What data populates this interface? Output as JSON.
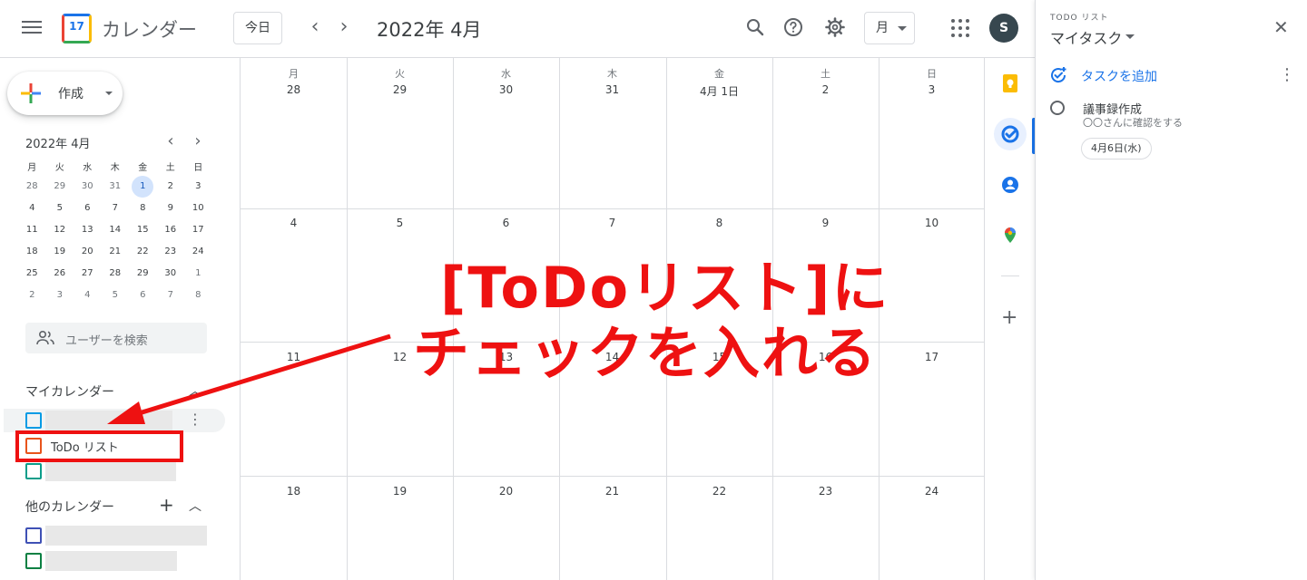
{
  "header": {
    "app_title": "カレンダー",
    "logo_number": "17",
    "today_label": "今日",
    "prev_label": "‹",
    "next_label": "›",
    "month_title": "2022年 4月",
    "view_label": "月",
    "avatar_initial": "S"
  },
  "sidebar": {
    "create_label": "作成",
    "mini_title": "2022年 4月",
    "mini_prev": "‹",
    "mini_next": "›",
    "weekdays": [
      "月",
      "火",
      "水",
      "木",
      "金",
      "土",
      "日"
    ],
    "weeks": [
      [
        "28",
        "29",
        "30",
        "31",
        "1",
        "2",
        "3"
      ],
      [
        "4",
        "5",
        "6",
        "7",
        "8",
        "9",
        "10"
      ],
      [
        "11",
        "12",
        "13",
        "14",
        "15",
        "16",
        "17"
      ],
      [
        "18",
        "19",
        "20",
        "21",
        "22",
        "23",
        "24"
      ],
      [
        "25",
        "26",
        "27",
        "28",
        "29",
        "30",
        "1"
      ],
      [
        "2",
        "3",
        "4",
        "5",
        "6",
        "7",
        "8"
      ]
    ],
    "search_users_placeholder": "ユーザーを検索",
    "my_calendars_title": "マイカレンダー",
    "todo_list_label": "ToDo リスト",
    "other_calendars_title": "他のカレンダー"
  },
  "grid": {
    "weekdays": [
      "月",
      "火",
      "水",
      "木",
      "金",
      "土",
      "日"
    ],
    "weeks": [
      [
        "28",
        "29",
        "30",
        "31",
        "4月 1日",
        "2",
        "3"
      ],
      [
        "4",
        "5",
        "6",
        "7",
        "8",
        "9",
        "10"
      ],
      [
        "11",
        "12",
        "13",
        "14",
        "15",
        "16",
        "17"
      ],
      [
        "18",
        "19",
        "20",
        "21",
        "22",
        "23",
        "24"
      ]
    ]
  },
  "task_panel": {
    "subtitle": "TODO リスト",
    "title": "マイタスク",
    "add_task_label": "タスクを追加",
    "task_title": "議事録作成",
    "task_note": "〇〇さんに確認をする",
    "task_date": "4月6日(水)"
  },
  "annotation": {
    "line1": "[ToDoリスト]に",
    "line2": "チェックを入れる",
    "color": "#ee1111"
  },
  "colors": {
    "accent_blue": "#1a73e8",
    "selected_day_bg": "#d2e3fc",
    "border": "#dadce0",
    "calendar1": "#039be5",
    "todo_calendar": "#e8541c",
    "calendar3": "#0b9d8a",
    "other_cal1": "#3f51b5",
    "other_cal2": "#0b8043"
  }
}
